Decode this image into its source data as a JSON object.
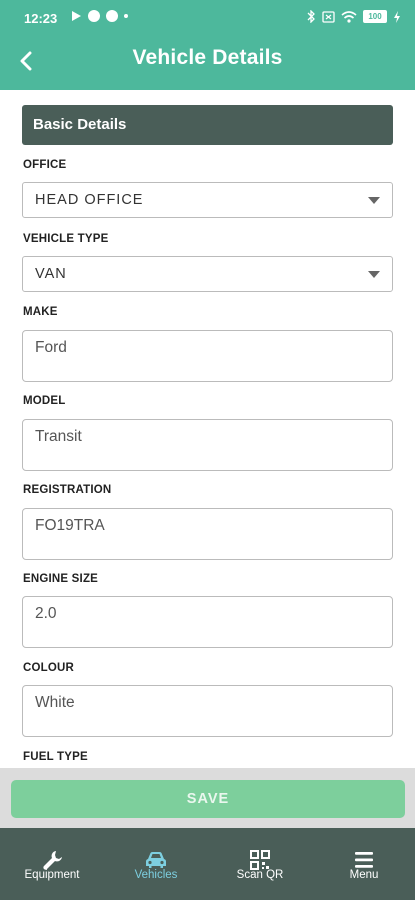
{
  "status_bar": {
    "time": "12:23",
    "battery": "100"
  },
  "header": {
    "title": "Vehicle Details"
  },
  "section": {
    "title": "Basic Details"
  },
  "fields": {
    "office": {
      "label": "OFFICE",
      "value": "HEAD OFFICE"
    },
    "vehicle_type": {
      "label": "VEHICLE TYPE",
      "value": "VAN"
    },
    "make": {
      "label": "MAKE",
      "value": "Ford"
    },
    "model": {
      "label": "MODEL",
      "value": "Transit"
    },
    "registration": {
      "label": "REGISTRATION",
      "value": "FO19TRA"
    },
    "engine_size": {
      "label": "ENGINE SIZE",
      "value": "2.0"
    },
    "colour": {
      "label": "COLOUR",
      "value": "White"
    },
    "fuel_type": {
      "label": "FUEL TYPE"
    }
  },
  "actions": {
    "save_label": "SAVE"
  },
  "nav": {
    "items": [
      {
        "label": "Equipment",
        "icon": "wrench-icon",
        "active": false
      },
      {
        "label": "Vehicles",
        "icon": "car-icon",
        "active": true
      },
      {
        "label": "Scan QR",
        "icon": "qr-code-icon",
        "active": false
      },
      {
        "label": "Menu",
        "icon": "menu-icon",
        "active": false
      }
    ]
  },
  "colors": {
    "header": "#4db89c",
    "section_header": "#4a5e58",
    "save_button": "#7dcf9c",
    "nav_background": "#4a5e58",
    "nav_active": "#7dcfe0"
  }
}
